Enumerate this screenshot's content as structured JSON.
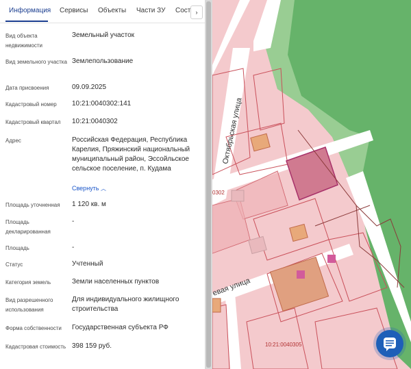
{
  "tabs": {
    "items": [
      "Информация",
      "Сервисы",
      "Объекты",
      "Части ЗУ",
      "Сост"
    ],
    "next_icon": "chevron-right-icon"
  },
  "properties": [
    {
      "label": "Вид объекта недвижимости",
      "value": "Земельный участок"
    },
    {
      "label": "Вид земельного участка",
      "value": "Землепользование"
    },
    {
      "label": "Дата присвоения",
      "value": "09.09.2025"
    },
    {
      "label": "Кадастровый номер",
      "value": "10:21:0040302:141"
    },
    {
      "label": "Кадастровый квартал",
      "value": "10:21:0040302"
    },
    {
      "label": "Адрес",
      "value": "Российская Федерация, Республика Карелия, Пряжинский национальный муниципальный район, Эссойльское сельское поселение, п. Кудама"
    },
    {
      "label": "Площадь уточненная",
      "value": "1 120 кв. м"
    },
    {
      "label": "Площадь декларированная",
      "value": "-"
    },
    {
      "label": "Площадь",
      "value": "-"
    },
    {
      "label": "Статус",
      "value": "Учтенный"
    },
    {
      "label": "Категория земель",
      "value": "Земли населенных пунктов"
    },
    {
      "label": "Вид разрешенного использования",
      "value": "Для индивидуального жилищного строительства"
    },
    {
      "label": "Форма собственности",
      "value": "Государственная субъекта РФ"
    },
    {
      "label": "Кадастровая стоимость",
      "value": "398 159 руб."
    }
  ],
  "collapse_link": "Свернуть",
  "map": {
    "street_labels": [
      "Октябрьская улица",
      "евая улица"
    ],
    "parcel_labels": [
      "0302",
      "10:21:0040305"
    ],
    "colors": {
      "parcel_fill": "#f2c4c8",
      "parcel_stroke": "#c9505a",
      "forest": "#66b36a",
      "road": "#ffffff",
      "selected": "#d07a90",
      "building": "#e8a97a"
    }
  },
  "chat_button": {
    "icon": "chat-icon"
  }
}
